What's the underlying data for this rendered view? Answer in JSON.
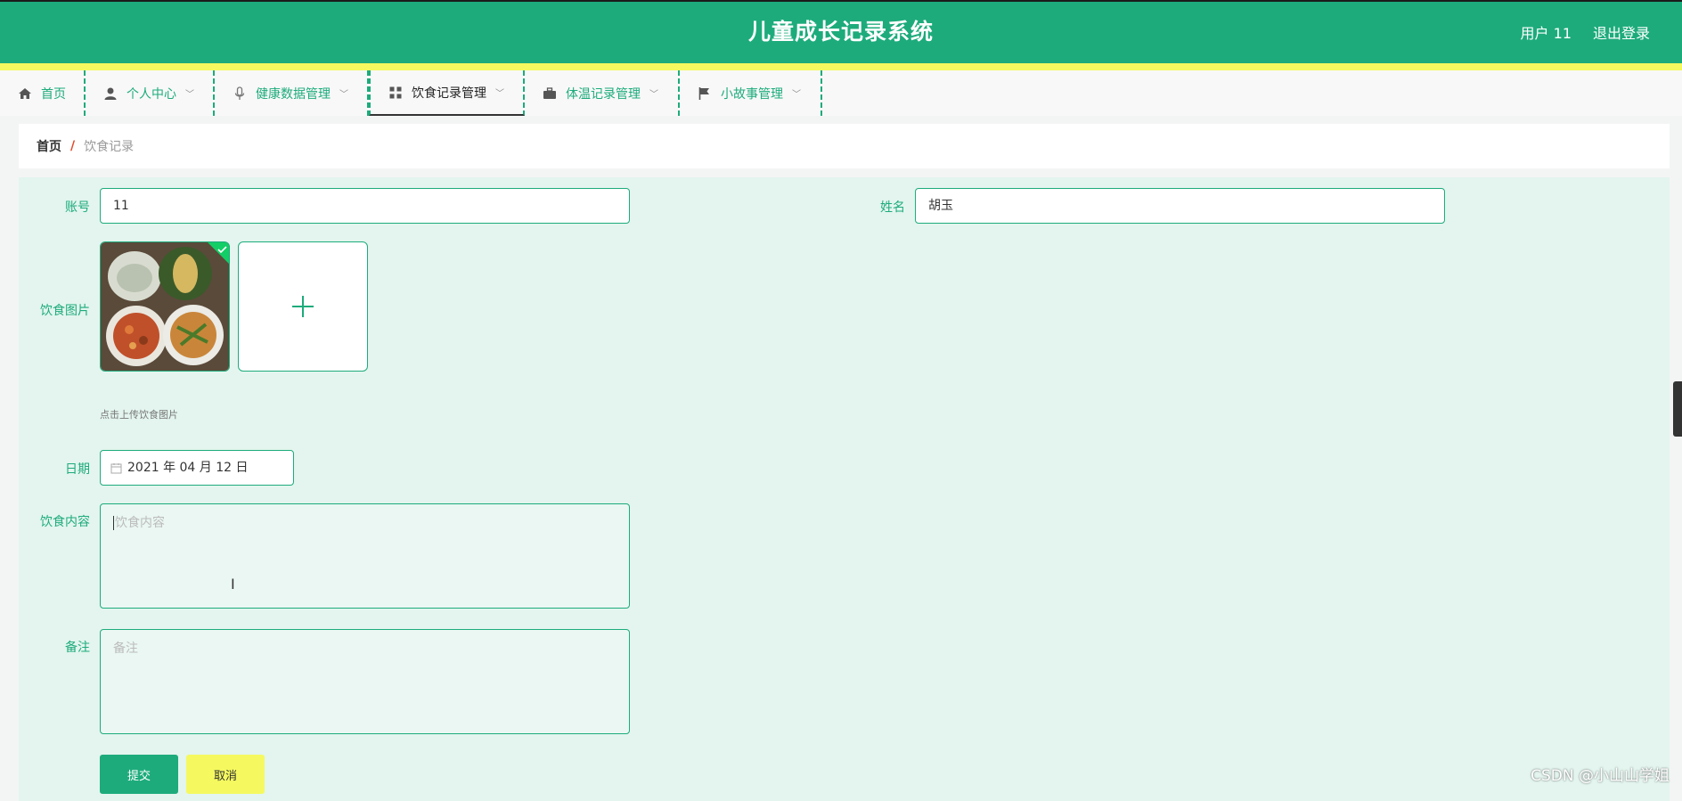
{
  "header": {
    "title": "儿童成长记录系统",
    "user": "用户 11",
    "logout": "退出登录"
  },
  "nav": {
    "items": [
      {
        "label": "首页",
        "icon": "home-icon"
      },
      {
        "label": "个人中心",
        "icon": "person-icon"
      },
      {
        "label": "健康数据管理",
        "icon": "microphone-icon"
      },
      {
        "label": "饮食记录管理",
        "icon": "grid-icon"
      },
      {
        "label": "体温记录管理",
        "icon": "briefcase-icon"
      },
      {
        "label": "小故事管理",
        "icon": "flag-icon"
      }
    ]
  },
  "breadcrumb": {
    "home": "首页",
    "separator": "/",
    "current": "饮食记录"
  },
  "form": {
    "account_label": "账号",
    "account_value": "11",
    "name_label": "姓名",
    "name_value": "胡玉",
    "image_label": "饮食图片",
    "image_hint": "点击上传饮食图片",
    "date_label": "日期",
    "date_value": "2021 年 04 月 12 日",
    "content_label": "饮食内容",
    "content_placeholder": "饮食内容",
    "remark_label": "备注",
    "remark_placeholder": "备注",
    "submit": "提交",
    "cancel": "取消"
  },
  "watermark": "CSDN @小山山学姐",
  "colors": {
    "primary": "#1dab7c",
    "accent_yellow": "#f5f95f",
    "panel_bg": "#e3f5ee"
  }
}
